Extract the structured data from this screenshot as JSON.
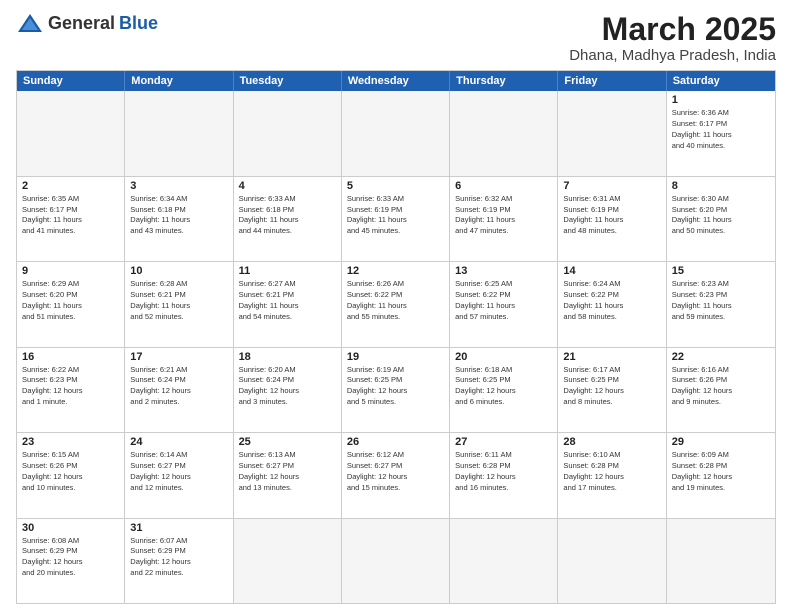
{
  "logo": {
    "general": "General",
    "blue": "Blue"
  },
  "title": "March 2025",
  "location": "Dhana, Madhya Pradesh, India",
  "headers": [
    "Sunday",
    "Monday",
    "Tuesday",
    "Wednesday",
    "Thursday",
    "Friday",
    "Saturday"
  ],
  "weeks": [
    [
      {
        "day": "",
        "info": ""
      },
      {
        "day": "",
        "info": ""
      },
      {
        "day": "",
        "info": ""
      },
      {
        "day": "",
        "info": ""
      },
      {
        "day": "",
        "info": ""
      },
      {
        "day": "",
        "info": ""
      },
      {
        "day": "1",
        "info": "Sunrise: 6:36 AM\nSunset: 6:17 PM\nDaylight: 11 hours\nand 40 minutes."
      }
    ],
    [
      {
        "day": "2",
        "info": "Sunrise: 6:35 AM\nSunset: 6:17 PM\nDaylight: 11 hours\nand 41 minutes."
      },
      {
        "day": "3",
        "info": "Sunrise: 6:34 AM\nSunset: 6:18 PM\nDaylight: 11 hours\nand 43 minutes."
      },
      {
        "day": "4",
        "info": "Sunrise: 6:33 AM\nSunset: 6:18 PM\nDaylight: 11 hours\nand 44 minutes."
      },
      {
        "day": "5",
        "info": "Sunrise: 6:33 AM\nSunset: 6:19 PM\nDaylight: 11 hours\nand 45 minutes."
      },
      {
        "day": "6",
        "info": "Sunrise: 6:32 AM\nSunset: 6:19 PM\nDaylight: 11 hours\nand 47 minutes."
      },
      {
        "day": "7",
        "info": "Sunrise: 6:31 AM\nSunset: 6:19 PM\nDaylight: 11 hours\nand 48 minutes."
      },
      {
        "day": "8",
        "info": "Sunrise: 6:30 AM\nSunset: 6:20 PM\nDaylight: 11 hours\nand 50 minutes."
      }
    ],
    [
      {
        "day": "9",
        "info": "Sunrise: 6:29 AM\nSunset: 6:20 PM\nDaylight: 11 hours\nand 51 minutes."
      },
      {
        "day": "10",
        "info": "Sunrise: 6:28 AM\nSunset: 6:21 PM\nDaylight: 11 hours\nand 52 minutes."
      },
      {
        "day": "11",
        "info": "Sunrise: 6:27 AM\nSunset: 6:21 PM\nDaylight: 11 hours\nand 54 minutes."
      },
      {
        "day": "12",
        "info": "Sunrise: 6:26 AM\nSunset: 6:22 PM\nDaylight: 11 hours\nand 55 minutes."
      },
      {
        "day": "13",
        "info": "Sunrise: 6:25 AM\nSunset: 6:22 PM\nDaylight: 11 hours\nand 57 minutes."
      },
      {
        "day": "14",
        "info": "Sunrise: 6:24 AM\nSunset: 6:22 PM\nDaylight: 11 hours\nand 58 minutes."
      },
      {
        "day": "15",
        "info": "Sunrise: 6:23 AM\nSunset: 6:23 PM\nDaylight: 11 hours\nand 59 minutes."
      }
    ],
    [
      {
        "day": "16",
        "info": "Sunrise: 6:22 AM\nSunset: 6:23 PM\nDaylight: 12 hours\nand 1 minute."
      },
      {
        "day": "17",
        "info": "Sunrise: 6:21 AM\nSunset: 6:24 PM\nDaylight: 12 hours\nand 2 minutes."
      },
      {
        "day": "18",
        "info": "Sunrise: 6:20 AM\nSunset: 6:24 PM\nDaylight: 12 hours\nand 3 minutes."
      },
      {
        "day": "19",
        "info": "Sunrise: 6:19 AM\nSunset: 6:25 PM\nDaylight: 12 hours\nand 5 minutes."
      },
      {
        "day": "20",
        "info": "Sunrise: 6:18 AM\nSunset: 6:25 PM\nDaylight: 12 hours\nand 6 minutes."
      },
      {
        "day": "21",
        "info": "Sunrise: 6:17 AM\nSunset: 6:25 PM\nDaylight: 12 hours\nand 8 minutes."
      },
      {
        "day": "22",
        "info": "Sunrise: 6:16 AM\nSunset: 6:26 PM\nDaylight: 12 hours\nand 9 minutes."
      }
    ],
    [
      {
        "day": "23",
        "info": "Sunrise: 6:15 AM\nSunset: 6:26 PM\nDaylight: 12 hours\nand 10 minutes."
      },
      {
        "day": "24",
        "info": "Sunrise: 6:14 AM\nSunset: 6:27 PM\nDaylight: 12 hours\nand 12 minutes."
      },
      {
        "day": "25",
        "info": "Sunrise: 6:13 AM\nSunset: 6:27 PM\nDaylight: 12 hours\nand 13 minutes."
      },
      {
        "day": "26",
        "info": "Sunrise: 6:12 AM\nSunset: 6:27 PM\nDaylight: 12 hours\nand 15 minutes."
      },
      {
        "day": "27",
        "info": "Sunrise: 6:11 AM\nSunset: 6:28 PM\nDaylight: 12 hours\nand 16 minutes."
      },
      {
        "day": "28",
        "info": "Sunrise: 6:10 AM\nSunset: 6:28 PM\nDaylight: 12 hours\nand 17 minutes."
      },
      {
        "day": "29",
        "info": "Sunrise: 6:09 AM\nSunset: 6:28 PM\nDaylight: 12 hours\nand 19 minutes."
      }
    ],
    [
      {
        "day": "30",
        "info": "Sunrise: 6:08 AM\nSunset: 6:29 PM\nDaylight: 12 hours\nand 20 minutes."
      },
      {
        "day": "31",
        "info": "Sunrise: 6:07 AM\nSunset: 6:29 PM\nDaylight: 12 hours\nand 22 minutes."
      },
      {
        "day": "",
        "info": ""
      },
      {
        "day": "",
        "info": ""
      },
      {
        "day": "",
        "info": ""
      },
      {
        "day": "",
        "info": ""
      },
      {
        "day": "",
        "info": ""
      }
    ]
  ]
}
